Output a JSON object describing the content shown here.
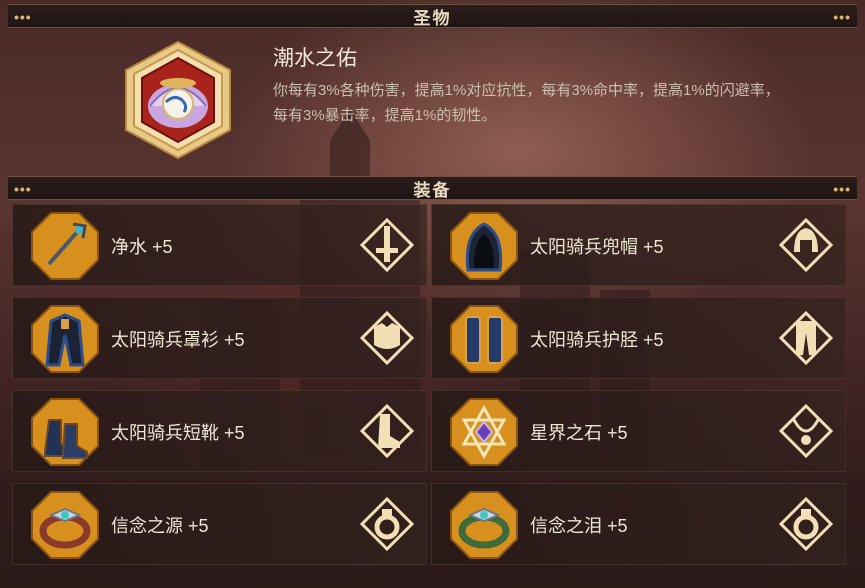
{
  "relic_section": {
    "title": "圣物"
  },
  "relic": {
    "name": "潮水之佑",
    "description": "你每有3%各种伤害，提高1%对应抗性，每有3%命中率，提高1%的闪避率，每有3%暴击率，提高1%的韧性。",
    "icon": "pearl-shell-icon"
  },
  "equipment_section": {
    "title": "装备"
  },
  "equipment": [
    {
      "label": "净水 +5",
      "item_icon": "trident-staff-icon",
      "slot_icon": "sword-slot-icon"
    },
    {
      "label": "太阳骑兵兜帽 +5",
      "item_icon": "hood-icon",
      "slot_icon": "helmet-slot-icon"
    },
    {
      "label": "太阳骑兵罩衫 +5",
      "item_icon": "robe-icon",
      "slot_icon": "armor-slot-icon"
    },
    {
      "label": "太阳骑兵护胫 +5",
      "item_icon": "greaves-icon",
      "slot_icon": "leg-slot-icon"
    },
    {
      "label": "太阳骑兵短靴 +5",
      "item_icon": "boots-icon",
      "slot_icon": "boot-slot-icon"
    },
    {
      "label": "星界之石 +5",
      "item_icon": "star-gem-icon",
      "slot_icon": "necklace-slot-icon"
    },
    {
      "label": "信念之源 +5",
      "item_icon": "ring-red-icon",
      "slot_icon": "ring-slot-icon"
    },
    {
      "label": "信念之泪 +5",
      "item_icon": "ring-green-icon",
      "slot_icon": "ring-slot-icon"
    }
  ],
  "colors": {
    "gold": "#d9a24a",
    "icon_bg": "#d7901e",
    "text": "#efe6d6"
  }
}
